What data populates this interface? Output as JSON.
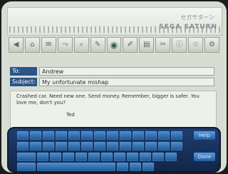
{
  "app": {
    "brand": "SEGA SATURN",
    "brand_jp": "セガサターン"
  },
  "toolbar": {
    "icons": [
      "back-icon",
      "home-icon",
      "mail-icon",
      "link-icon",
      "search-icon",
      "pen-icon",
      "globe-icon",
      "edit-icon",
      "document-icon",
      "tools-icon",
      "info-icon",
      "star-icon",
      "settings-icon"
    ]
  },
  "compose": {
    "to_label": "To:",
    "to_value": "Andrew",
    "subject_label": "Subject:",
    "subject_value": "My unfortunate mishap",
    "body": "Crashed car. Need new one. Send money. Remember, bigger is safer. You love me, don't you?",
    "signature": "Ted"
  },
  "keyboard": {
    "help_label": "Help",
    "done_label": "Done"
  }
}
